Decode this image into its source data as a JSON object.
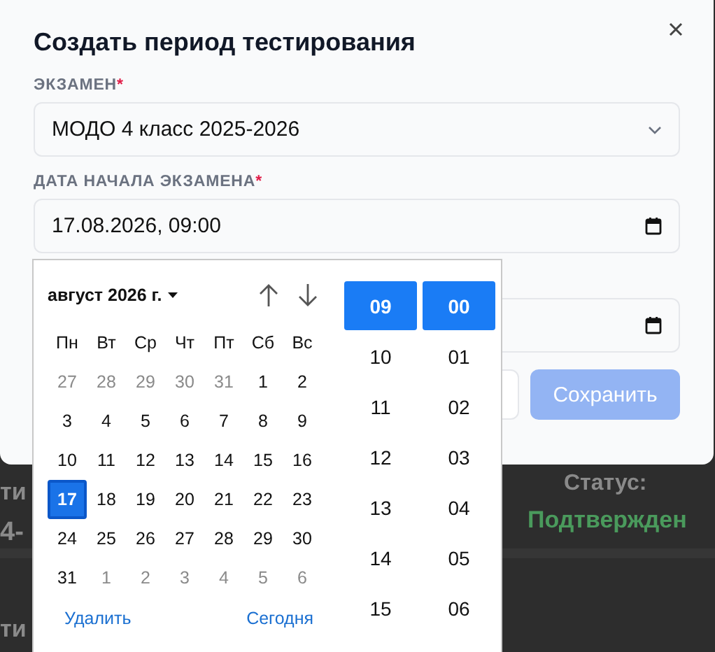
{
  "background": {
    "rows": [
      {
        "left": [
          "ти",
          "4-"
        ],
        "status_label": "Статус:",
        "status": "Подтвержден"
      },
      {
        "left": [
          "ти"
        ]
      }
    ]
  },
  "dialog": {
    "title": "Создать период тестирования",
    "fields": [
      {
        "kind": "select",
        "label": "ЭКЗАМЕН",
        "required_mark": "*",
        "value": "МОДО 4 класс 2025-2026"
      },
      {
        "kind": "datetime",
        "label": "ДАТА НАЧАЛА ЭКЗАМЕНА",
        "required_mark": "*",
        "value": "17.08.2026, 09:00"
      },
      {
        "kind": "datetime"
      }
    ],
    "buttons": [
      {
        "kind": "secondary"
      },
      {
        "kind": "primary",
        "label": "Сохранить",
        "disabled": true
      }
    ]
  },
  "picker": {
    "month": "август 2026 г.",
    "weekdays": [
      "Пн",
      "Вт",
      "Ср",
      "Чт",
      "Пт",
      "Сб",
      "Вс"
    ],
    "days": [
      {
        "label": "27",
        "outside": true,
        "selected": false
      },
      {
        "label": "28",
        "outside": true,
        "selected": false
      },
      {
        "label": "29",
        "outside": true,
        "selected": false
      },
      {
        "label": "30",
        "outside": true,
        "selected": false
      },
      {
        "label": "31",
        "outside": true,
        "selected": false
      },
      {
        "label": "1",
        "outside": false,
        "selected": false
      },
      {
        "label": "2",
        "outside": false,
        "selected": false
      },
      {
        "label": "3",
        "outside": false,
        "selected": false
      },
      {
        "label": "4",
        "outside": false,
        "selected": false
      },
      {
        "label": "5",
        "outside": false,
        "selected": false
      },
      {
        "label": "6",
        "outside": false,
        "selected": false
      },
      {
        "label": "7",
        "outside": false,
        "selected": false
      },
      {
        "label": "8",
        "outside": false,
        "selected": false
      },
      {
        "label": "9",
        "outside": false,
        "selected": false
      },
      {
        "label": "10",
        "outside": false,
        "selected": false
      },
      {
        "label": "11",
        "outside": false,
        "selected": false
      },
      {
        "label": "12",
        "outside": false,
        "selected": false
      },
      {
        "label": "13",
        "outside": false,
        "selected": false
      },
      {
        "label": "14",
        "outside": false,
        "selected": false
      },
      {
        "label": "15",
        "outside": false,
        "selected": false
      },
      {
        "label": "16",
        "outside": false,
        "selected": false
      },
      {
        "label": "17",
        "outside": false,
        "selected": true
      },
      {
        "label": "18",
        "outside": false,
        "selected": false
      },
      {
        "label": "19",
        "outside": false,
        "selected": false
      },
      {
        "label": "20",
        "outside": false,
        "selected": false
      },
      {
        "label": "21",
        "outside": false,
        "selected": false
      },
      {
        "label": "22",
        "outside": false,
        "selected": false
      },
      {
        "label": "23",
        "outside": false,
        "selected": false
      },
      {
        "label": "24",
        "outside": false,
        "selected": false
      },
      {
        "label": "25",
        "outside": false,
        "selected": false
      },
      {
        "label": "26",
        "outside": false,
        "selected": false
      },
      {
        "label": "27",
        "outside": false,
        "selected": false
      },
      {
        "label": "28",
        "outside": false,
        "selected": false
      },
      {
        "label": "29",
        "outside": false,
        "selected": false
      },
      {
        "label": "30",
        "outside": false,
        "selected": false
      },
      {
        "label": "31",
        "outside": false,
        "selected": false
      },
      {
        "label": "1",
        "outside": true,
        "selected": false
      },
      {
        "label": "2",
        "outside": true,
        "selected": false
      },
      {
        "label": "3",
        "outside": true,
        "selected": false
      },
      {
        "label": "4",
        "outside": true,
        "selected": false
      },
      {
        "label": "5",
        "outside": true,
        "selected": false
      },
      {
        "label": "6",
        "outside": true,
        "selected": false
      }
    ],
    "clear": "Удалить",
    "today": "Сегодня",
    "hours": [
      {
        "label": "09",
        "selected": true
      },
      {
        "label": "10",
        "selected": false
      },
      {
        "label": "11",
        "selected": false
      },
      {
        "label": "12",
        "selected": false
      },
      {
        "label": "13",
        "selected": false
      },
      {
        "label": "14",
        "selected": false
      },
      {
        "label": "15",
        "selected": false
      }
    ],
    "minutes": [
      {
        "label": "00",
        "selected": true
      },
      {
        "label": "01",
        "selected": false
      },
      {
        "label": "02",
        "selected": false
      },
      {
        "label": "03",
        "selected": false
      },
      {
        "label": "04",
        "selected": false
      },
      {
        "label": "05",
        "selected": false
      },
      {
        "label": "06",
        "selected": false
      }
    ]
  }
}
